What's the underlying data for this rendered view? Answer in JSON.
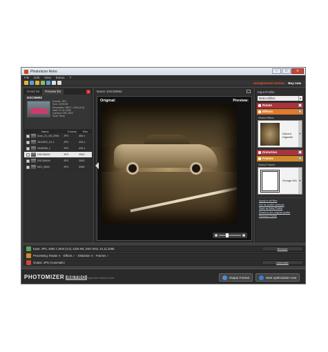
{
  "window": {
    "title": "Photomizer Retro",
    "controls": [
      "–",
      "□",
      "✕"
    ]
  },
  "menu": [
    "File",
    "Edit",
    "View",
    "Extras",
    "?"
  ],
  "promo": {
    "register": "Unregistered version",
    "buy": "Buy now"
  },
  "left": {
    "tabs": [
      "Detail list",
      "Preview list"
    ],
    "close": "x",
    "selected_file": "DSC06692",
    "meta": [
      "Format: JPG",
      "Size: 2225 KB",
      "Resolution: 2592 × 1944 (4:3)",
      "Date: 01.11.2006",
      "Camera: DSC-W12",
      "Scan: Sony"
    ],
    "columns": [
      "Name",
      "Format",
      "Res"
    ],
    "rows": [
      {
        "name": "scan_21_08_2006",
        "format": "JPG",
        "res": "460 x"
      },
      {
        "name": "1510602_01-1",
        "format": "JPG",
        "res": "425 x"
      },
      {
        "name": "1548398_1",
        "format": "JPG",
        "res": "425 x"
      },
      {
        "name": "DSC06692",
        "format": "JPG",
        "res": "2592",
        "selected": true
      },
      {
        "name": "DSC06699",
        "format": "JPG",
        "res": "2592"
      },
      {
        "name": "IMG_6869",
        "format": "JPG",
        "res": "3456"
      }
    ]
  },
  "center": {
    "name_label": "Name: DSC06692",
    "original": "Original:",
    "preview": "Preview:"
  },
  "right": {
    "input_profile_label": "Input Profile:",
    "profile_value": "Retro Effect",
    "sections": {
      "rotate": "Rotate",
      "effects": "Effects",
      "distortion": "Distortion",
      "frames": "Frames"
    },
    "select_effect": "Select Effect:",
    "effect_name": "Dacora Dignette",
    "select_frame": "Select Frame:",
    "frame_name": "Grunge #01",
    "links": [
      "Apply to all files",
      "Set as profile defaults",
      "Save as New Profile",
      "Reset to the original profile",
      "Remove Profile"
    ]
  },
  "info": {
    "input": "Input: JPG, 2592 x 1944 (4:3), 2225 KB, DSC-W12, 01.11.2006",
    "input_action": "Remove",
    "processing": "Processing: Rotate ✕ · Effects ✓ · Distortion ✕ · Frames ✓",
    "output": "Output: JPG (Automatic)",
    "output_action": "Automatic"
  },
  "footer": {
    "logo": "PHOTOMIZER",
    "logo_tag": "RETRO",
    "copyright": "Copyright © Engelmann Media GmbH",
    "output_format": "Output Format",
    "start": "Start optimization now"
  },
  "colors": {
    "accent": "#e07b2c",
    "red": "#a8343d",
    "link": "#cdd6e0"
  }
}
